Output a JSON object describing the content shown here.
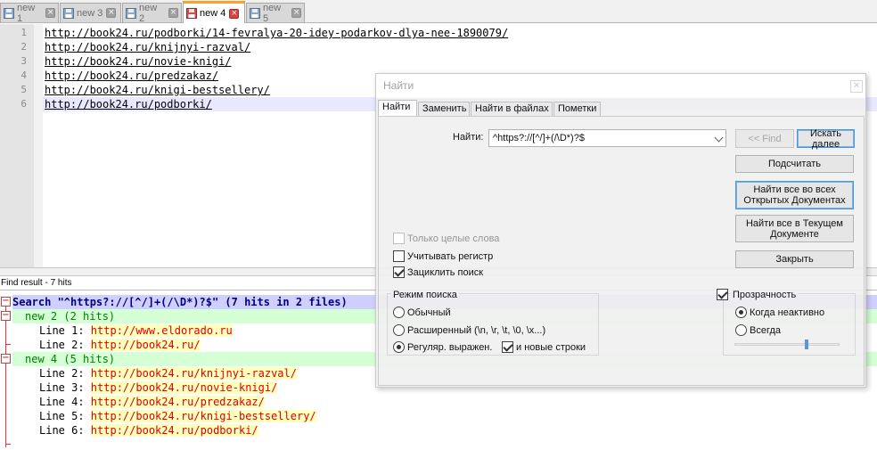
{
  "tabs": [
    {
      "label": "new 1",
      "active": false
    },
    {
      "label": "new 3",
      "active": false
    },
    {
      "label": "new 2",
      "active": false
    },
    {
      "label": "new 4",
      "active": true
    },
    {
      "label": "new 5",
      "active": false
    }
  ],
  "editor": {
    "lines": [
      {
        "num": "1",
        "text": "http://book24.ru/podborki/14-fevralya-20-idey-podarkov-dlya-nee-1890079/"
      },
      {
        "num": "2",
        "text": "http://book24.ru/knijnyi-razval/"
      },
      {
        "num": "3",
        "text": "http://book24.ru/novie-knigi/"
      },
      {
        "num": "4",
        "text": "http://book24.ru/predzakaz/"
      },
      {
        "num": "5",
        "text": "http://book24.ru/knigi-bestsellery/"
      },
      {
        "num": "6",
        "text": "http://book24.ru/podborki/"
      }
    ],
    "current_line": 6
  },
  "find_results": {
    "title": "Find result - 7 hits",
    "search_line": "Search \"^https?://[^/]+(/\\D*)?$\" (7 hits in 2 files)",
    "files": [
      {
        "header": "new 2 (2 hits)",
        "hits": [
          {
            "prefix": "Line 1: ",
            "url": "http://www.eldorado.ru"
          },
          {
            "prefix": "Line 2: ",
            "url": "http://book24.ru/"
          }
        ]
      },
      {
        "header": "new 4 (5 hits)",
        "hits": [
          {
            "prefix": "Line 2: ",
            "url": "http://book24.ru/knijnyi-razval/"
          },
          {
            "prefix": "Line 3: ",
            "url": "http://book24.ru/novie-knigi/"
          },
          {
            "prefix": "Line 4: ",
            "url": "http://book24.ru/predzakaz/"
          },
          {
            "prefix": "Line 5: ",
            "url": "http://book24.ru/knigi-bestsellery/"
          },
          {
            "prefix": "Line 6: ",
            "url": "http://book24.ru/podborki/"
          }
        ]
      }
    ]
  },
  "dialog": {
    "title": "Найти",
    "close_glyph": "✕",
    "tabs": [
      "Найти",
      "Заменить",
      "Найти в файлах",
      "Пометки"
    ],
    "find_label": "Найти:",
    "find_value": "^https?://[^/]+(/\\D*)?$",
    "buttons": {
      "find_prev": "<< Find",
      "find_next": "Искать далее",
      "count": "Подсчитать",
      "find_all_open": "Найти все во всех Открытых Документах",
      "find_all_current": "Найти все в Текущем Документе",
      "close": "Закрыть"
    },
    "options": {
      "whole_word": "Только целые слова",
      "match_case": "Учитывать регистр",
      "wrap": "Зациклить поиск"
    },
    "search_mode": {
      "title": "Режим поиска",
      "normal": "Обычный",
      "extended": "Расширенный (\\n, \\r, \\t, \\0, \\x...)",
      "regex": "Регуляр. выражен.",
      "newline": "и новые строки"
    },
    "transparency": {
      "title": "Прозрачность",
      "on_inactive": "Когда неактивно",
      "always": "Всегда",
      "level": 0.7
    }
  }
}
